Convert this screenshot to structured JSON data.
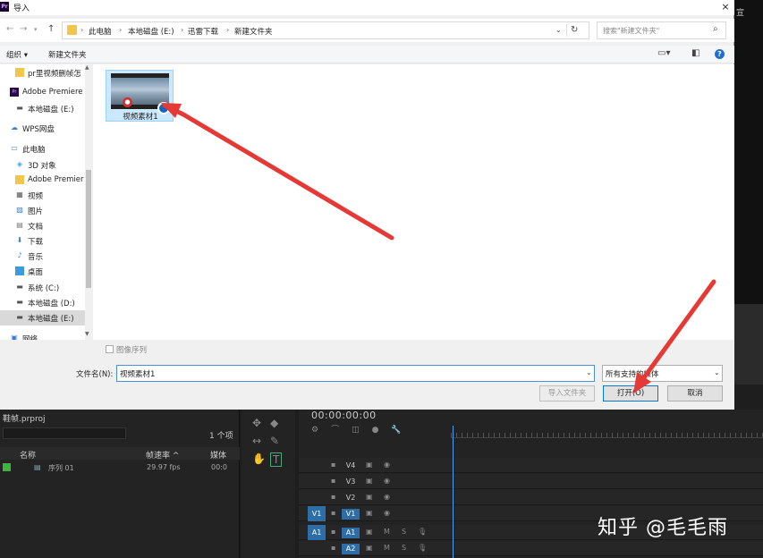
{
  "window": {
    "title": "导入",
    "close": "×",
    "app_icon": "Pr"
  },
  "address": {
    "crumbs": [
      "此电脑",
      "本地磁盘 (E:)",
      "迅雷下载",
      "新建文件夹"
    ],
    "search_placeholder": "搜索\"新建文件夹\""
  },
  "toolbar": {
    "organize": "组织 ▾",
    "new_folder": "新建文件夹"
  },
  "nav": {
    "items": [
      {
        "label": "pr里视频删帧怎",
        "icon": "folder-icon"
      },
      {
        "label": "Adobe Premiere",
        "icon": "premiere-icon"
      },
      {
        "label": "本地磁盘 (E:)",
        "icon": "drive-icon"
      },
      {
        "label": "WPS网盘",
        "icon": "cloud-icon"
      },
      {
        "label": "此电脑",
        "icon": "pc-icon"
      },
      {
        "label": "3D 对象",
        "icon": "3d-icon"
      },
      {
        "label": "Adobe Premier",
        "icon": "folder-icon"
      },
      {
        "label": "视频",
        "icon": "video-icon"
      },
      {
        "label": "图片",
        "icon": "picture-icon"
      },
      {
        "label": "文档",
        "icon": "document-icon"
      },
      {
        "label": "下载",
        "icon": "download-icon"
      },
      {
        "label": "音乐",
        "icon": "music-icon"
      },
      {
        "label": "桌面",
        "icon": "desktop-icon"
      },
      {
        "label": "系统 (C:)",
        "icon": "drive-icon"
      },
      {
        "label": "本地磁盘 (D:)",
        "icon": "drive-icon"
      },
      {
        "label": "本地磁盘 (E:)",
        "icon": "drive-icon",
        "selected": true
      },
      {
        "label": "网络",
        "icon": "network-icon"
      }
    ]
  },
  "files": [
    {
      "name": "视频素材1"
    }
  ],
  "bottom": {
    "image_sequence": "图像序列",
    "filename_label": "文件名(N):",
    "filename_value": "视频素材1",
    "filetype_value": "所有支持的媒体",
    "import_folder": "导入文件夹",
    "open": "打开(O)",
    "cancel": "取消"
  },
  "premiere": {
    "right_label": "宣",
    "project_title": "鞋帧.prproj",
    "item_count": "1 个项",
    "col_name": "名称",
    "col_framerate": "帧速率 ^",
    "col_media": "媒体",
    "sequence_name": "序列 01",
    "sequence_fps": "29.97 fps",
    "sequence_media": "00:0",
    "timecode": "00:00:00:00",
    "tracks": [
      "V4",
      "V3",
      "V2",
      "V1",
      "A1",
      "A2"
    ]
  },
  "watermark": "知乎 @毛毛雨",
  "colors": {
    "selection": "#cce8ff",
    "arrow": "#e53935",
    "accent": "#0078d7"
  }
}
